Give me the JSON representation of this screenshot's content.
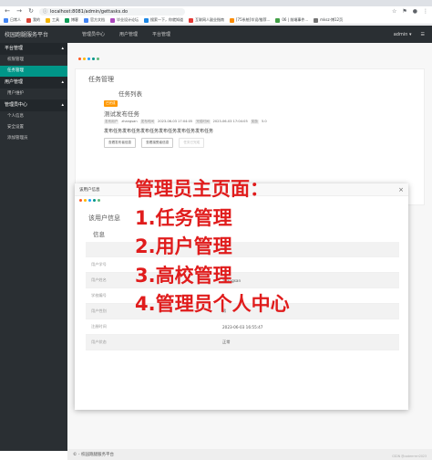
{
  "browser": {
    "url": "localhost:8081/admin/gettasks.do",
    "bookmarks": [
      {
        "label": "日常人",
        "color": "#4285f4"
      },
      {
        "label": "我的",
        "color": "#db4437"
      },
      {
        "label": "工具",
        "color": "#f4b400"
      },
      {
        "label": "博客",
        "color": "#0f9d58"
      },
      {
        "label": "官方文档",
        "color": "#4285f4"
      },
      {
        "label": "毕业设计论坛",
        "color": "#ab47bc"
      },
      {
        "label": "搜索一下，你就知道",
        "color": "#1e88e5"
      },
      {
        "label": "互联网人副业指南",
        "color": "#e53935"
      },
      {
        "label": "[75系统]毕设/推荐...",
        "color": "#fb8c00"
      },
      {
        "label": "06 | 前端事件...",
        "color": "#43a047"
      },
      {
        "label": "mksz-博12页",
        "color": "#757575"
      }
    ]
  },
  "header": {
    "brand": "校园跑腿服务平台",
    "nav": [
      "管理员中心",
      "用户管理",
      "平台管理"
    ],
    "user": "admin"
  },
  "sidebar": [
    {
      "group": "平台管理",
      "items": [
        "权限管理",
        "任务管理"
      ]
    },
    {
      "group": "用户管理",
      "items": [
        "用户维护"
      ]
    },
    {
      "group": "管理员中心",
      "items": [
        "个人信息",
        "安全设置",
        "添加管理员"
      ]
    }
  ],
  "sidebar_active": "任务管理",
  "main": {
    "section_title": "任务管理",
    "list_title": "任务列表",
    "task": {
      "badge": "已完成",
      "name": "测试发布任务",
      "meta": [
        {
          "label": "发布用户",
          "value": "zhangsan"
        },
        {
          "label": "发布时间",
          "value": "2023-06-03 17:04:05"
        },
        {
          "label": "完成时间",
          "value": "2023-06-03 17:04:05"
        },
        {
          "label": "奖励",
          "value": "5.0"
        }
      ],
      "description": "发布任务发布任务发布任务发布任务发布任务发布任务",
      "buttons": [
        "查看发布者信息",
        "查看接受者信息",
        "任务已完成"
      ]
    }
  },
  "modal": {
    "header": "该用户信息",
    "title": "该用户信息",
    "info_label": "信息",
    "rows": [
      {
        "k": "",
        "v": ""
      },
      {
        "k": "用户学号",
        "v": ""
      },
      {
        "k": "用户姓名",
        "v": "zhangsan"
      },
      {
        "k": "学校编号",
        "v": ""
      },
      {
        "k": "用户性别",
        "v": "男"
      },
      {
        "k": "注册时间",
        "v": "2023-06-03 16:55:47"
      },
      {
        "k": "用户状态",
        "v": "正常"
      }
    ]
  },
  "overlay": {
    "lines": [
      "管理员主页面：",
      "1.任务管理",
      "2.用户管理",
      "3.高校管理",
      "4.管理员个人中心"
    ]
  },
  "footer": {
    "text": "© - 校园跑腿服务平台",
    "watermark": "CSDN @coderrrrrrr2023"
  },
  "colors": {
    "accent": "#009688",
    "dark": "#2a2f33",
    "overlay": "#e01c1c",
    "dots": [
      "#ff5722",
      "#ffb800",
      "#1e9fff",
      "#009688",
      "#5fb878"
    ]
  }
}
